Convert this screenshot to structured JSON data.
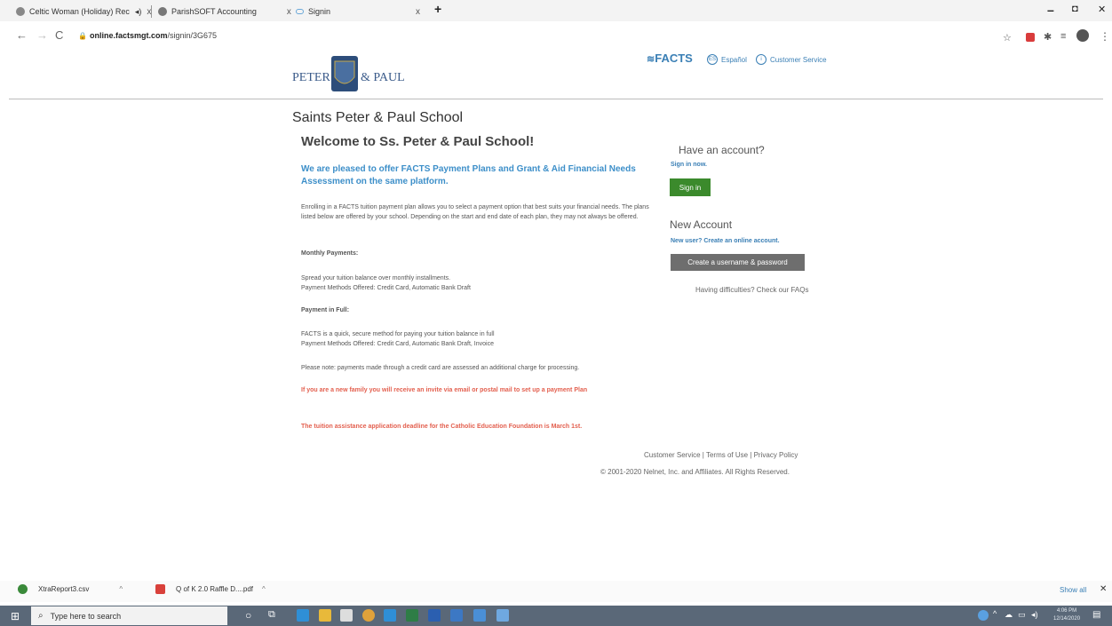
{
  "browser": {
    "tabs": [
      {
        "title": "Celtic Woman (Holiday) Rec",
        "close": "x"
      },
      {
        "title": "ParishSOFT Accounting",
        "close": "x"
      },
      {
        "title": "Signin",
        "close": "x"
      }
    ],
    "new_tab": "+",
    "url_host": "online.factsmgt.com",
    "url_path": "/signin/3G675",
    "window_controls": {
      "minimize": "–",
      "maximize": "◘",
      "close": "✕"
    }
  },
  "header": {
    "logo_text": "PETER & PAUL",
    "facts_logo": "FACTS",
    "espanol_label": "Español",
    "customer_service_label": "Customer Service"
  },
  "content": {
    "school_name": "Saints Peter & Paul School",
    "welcome": "Welcome to Ss. Peter & Paul School!",
    "offer": "We are pleased to offer FACTS Payment Plans and Grant & Aid Financial Needs Assessment on the same platform.",
    "intro": "Enrolling in a FACTS tuition payment plan allows you to select a payment option that best suits your financial needs. The plans listed below are offered by your school. Depending on the start and end date of each plan, they may not always be offered.",
    "monthly_heading": "Monthly Payments:",
    "monthly_desc": "Spread your tuition balance over monthly installments.",
    "monthly_methods": "Payment Methods Offered: Credit Card, Automatic Bank Draft",
    "full_heading": "Payment in Full:",
    "full_desc": "FACTS is a quick, secure method for paying your tuition balance in full",
    "full_methods": "Payment Methods Offered: Credit Card, Automatic Bank Draft, Invoice",
    "note": "Please note: payments made through a credit card are assessed an additional charge for processing.",
    "new_family": "If you are a new family you will receive an invite via email or postal mail to set up a payment Plan",
    "deadline": "The tuition assistance application deadline for the Catholic Education Foundation is March 1st."
  },
  "sidebar": {
    "have_account": "Have an account?",
    "sign_in_now": "Sign in now.",
    "sign_in_button": "Sign in",
    "new_account": "New Account",
    "new_user_link": "New user? Create an online account.",
    "create_button": "Create a username & password",
    "help": "Having difficulties? Check our FAQs"
  },
  "footer": {
    "links": "Customer Service | Terms of Use | Privacy Policy",
    "copyright": "© 2001-2020 Nelnet, Inc. and Affiliates. All Rights Reserved."
  },
  "downloads": {
    "items": [
      {
        "name": "XtraReport3.csv"
      },
      {
        "name": "Q of K 2.0 Raffle D....pdf"
      }
    ],
    "show_all": "Show all",
    "close": "✕"
  },
  "taskbar": {
    "search_placeholder": "Type here to search",
    "time": "4:06 PM",
    "date": "12/14/2020"
  },
  "colors": {
    "accent_blue": "#3d8fc9",
    "signin_green": "#3b8a2c",
    "alert_red": "#e3604f",
    "taskbar": "#5a6878"
  }
}
